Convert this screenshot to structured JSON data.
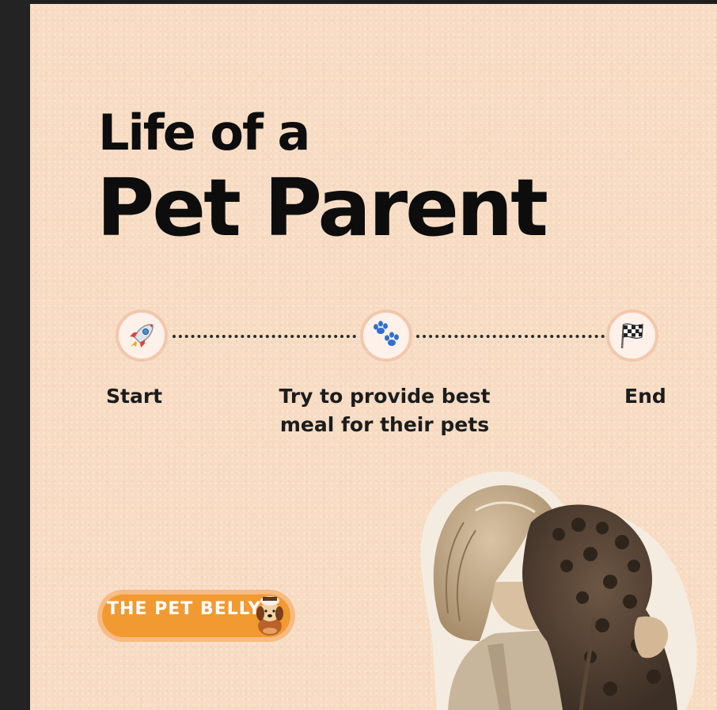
{
  "title": {
    "line1": "Life of a",
    "line2": "Pet Parent"
  },
  "steps": [
    {
      "label": "Start",
      "icon": "rocket-icon"
    },
    {
      "label_line1": "Try to provide best",
      "label_line2": "meal for their pets",
      "icon": "paw-prints-icon"
    },
    {
      "label": "End",
      "icon": "checkered-flag-icon"
    }
  ],
  "logo": {
    "text": "THE PET BELLY"
  },
  "colors": {
    "background": "#f7dcc3",
    "title": "#0d0d0d",
    "circle_fill": "#fdf1ea",
    "circle_ring": "#f3c7ac",
    "logo_orange": "#f29a32"
  }
}
